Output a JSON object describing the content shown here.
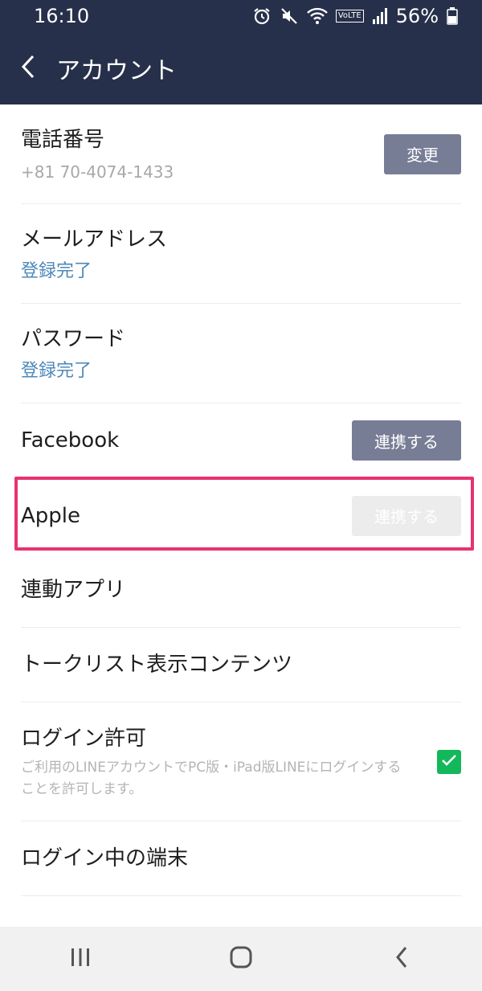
{
  "status_bar": {
    "time": "16:10",
    "battery_percent": "56%",
    "volte_label": "VoLTE"
  },
  "header": {
    "title": "アカウント"
  },
  "rows": {
    "phone": {
      "title": "電話番号",
      "value": "+81 70-4074-1433",
      "button": "変更"
    },
    "email": {
      "title": "メールアドレス",
      "status": "登録完了"
    },
    "password": {
      "title": "パスワード",
      "status": "登録完了"
    },
    "facebook": {
      "title": "Facebook",
      "button": "連携する"
    },
    "apple": {
      "title": "Apple",
      "button": "連携する"
    },
    "linked_apps": {
      "title": "連動アプリ"
    },
    "talklist": {
      "title": "トークリスト表示コンテンツ"
    },
    "login_permission": {
      "title": "ログイン許可",
      "description": "ご利用のLINEアカウントでPC版・iPad版LINEにログインすることを許可します。",
      "checked": true
    },
    "logged_in_devices": {
      "title": "ログイン中の端末"
    }
  },
  "colors": {
    "header_bg": "#26304a",
    "button_bg": "#787d96",
    "link_blue": "#4d88b8",
    "highlight": "#e8336e",
    "check_green": "#12b85a"
  }
}
